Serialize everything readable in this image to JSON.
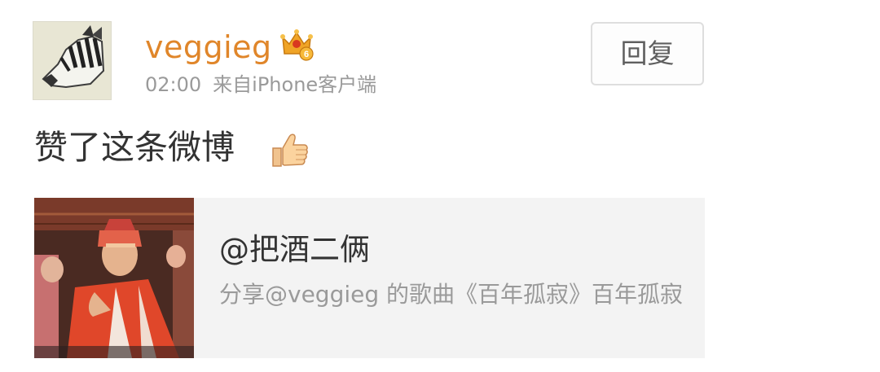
{
  "post": {
    "username": "veggieg",
    "time": "02:00",
    "source": "来自iPhone客户端",
    "reply_label": "回复",
    "text": "赞了这条微博"
  },
  "share_card": {
    "title": "@把酒二俩",
    "description": "分享@veggieg 的歌曲《百年孤寂》百年孤寂"
  },
  "icons": {
    "avatar": "zebra-avatar",
    "badge": "crown-vip-icon",
    "emoji": "thumbs-up-icon"
  },
  "colors": {
    "username": "#e0862a",
    "meta_text": "#9a9a9a",
    "card_background": "#f3f3f3"
  }
}
